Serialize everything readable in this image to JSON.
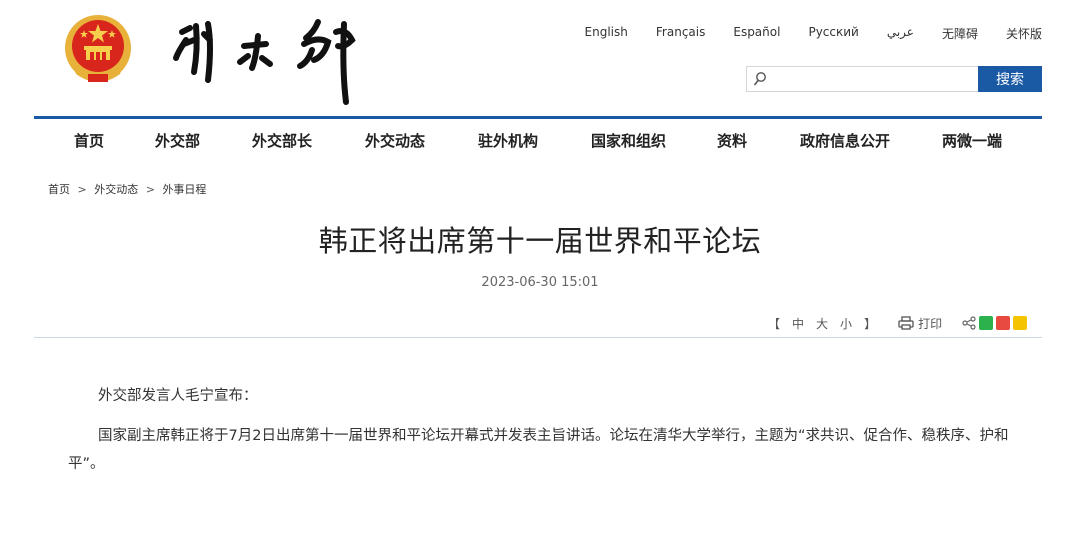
{
  "header": {
    "languages": [
      "English",
      "Français",
      "Español",
      "Русский",
      "عربي",
      "无障碍",
      "关怀版"
    ],
    "search": {
      "placeholder": "",
      "button_label": "搜索"
    }
  },
  "nav": {
    "items": [
      "首页",
      "外交部",
      "外交部长",
      "外交动态",
      "驻外机构",
      "国家和组织",
      "资料",
      "政府信息公开",
      "两微一端"
    ]
  },
  "breadcrumb": [
    "首页",
    "外交动态",
    "外事日程"
  ],
  "breadcrumb_sep": ">",
  "article": {
    "title": "韩正将出席第十一届世界和平论坛",
    "date": "2023-06-30 15:01",
    "font_size_label_open": "【",
    "font_size_options": [
      "中",
      "大",
      "小"
    ],
    "font_size_label_close": "】",
    "print_label": "打印",
    "paragraphs": [
      "外交部发言人毛宁宣布：",
      "国家副主席韩正将于7月2日出席第十一届世界和平论坛开幕式并发表主旨讲话。论坛在清华大学举行，主题为“求共识、促合作、稳秩序、护和平”。"
    ]
  },
  "colors": {
    "brand_blue": "#1a5aa5",
    "divider": "#c9dbea"
  }
}
